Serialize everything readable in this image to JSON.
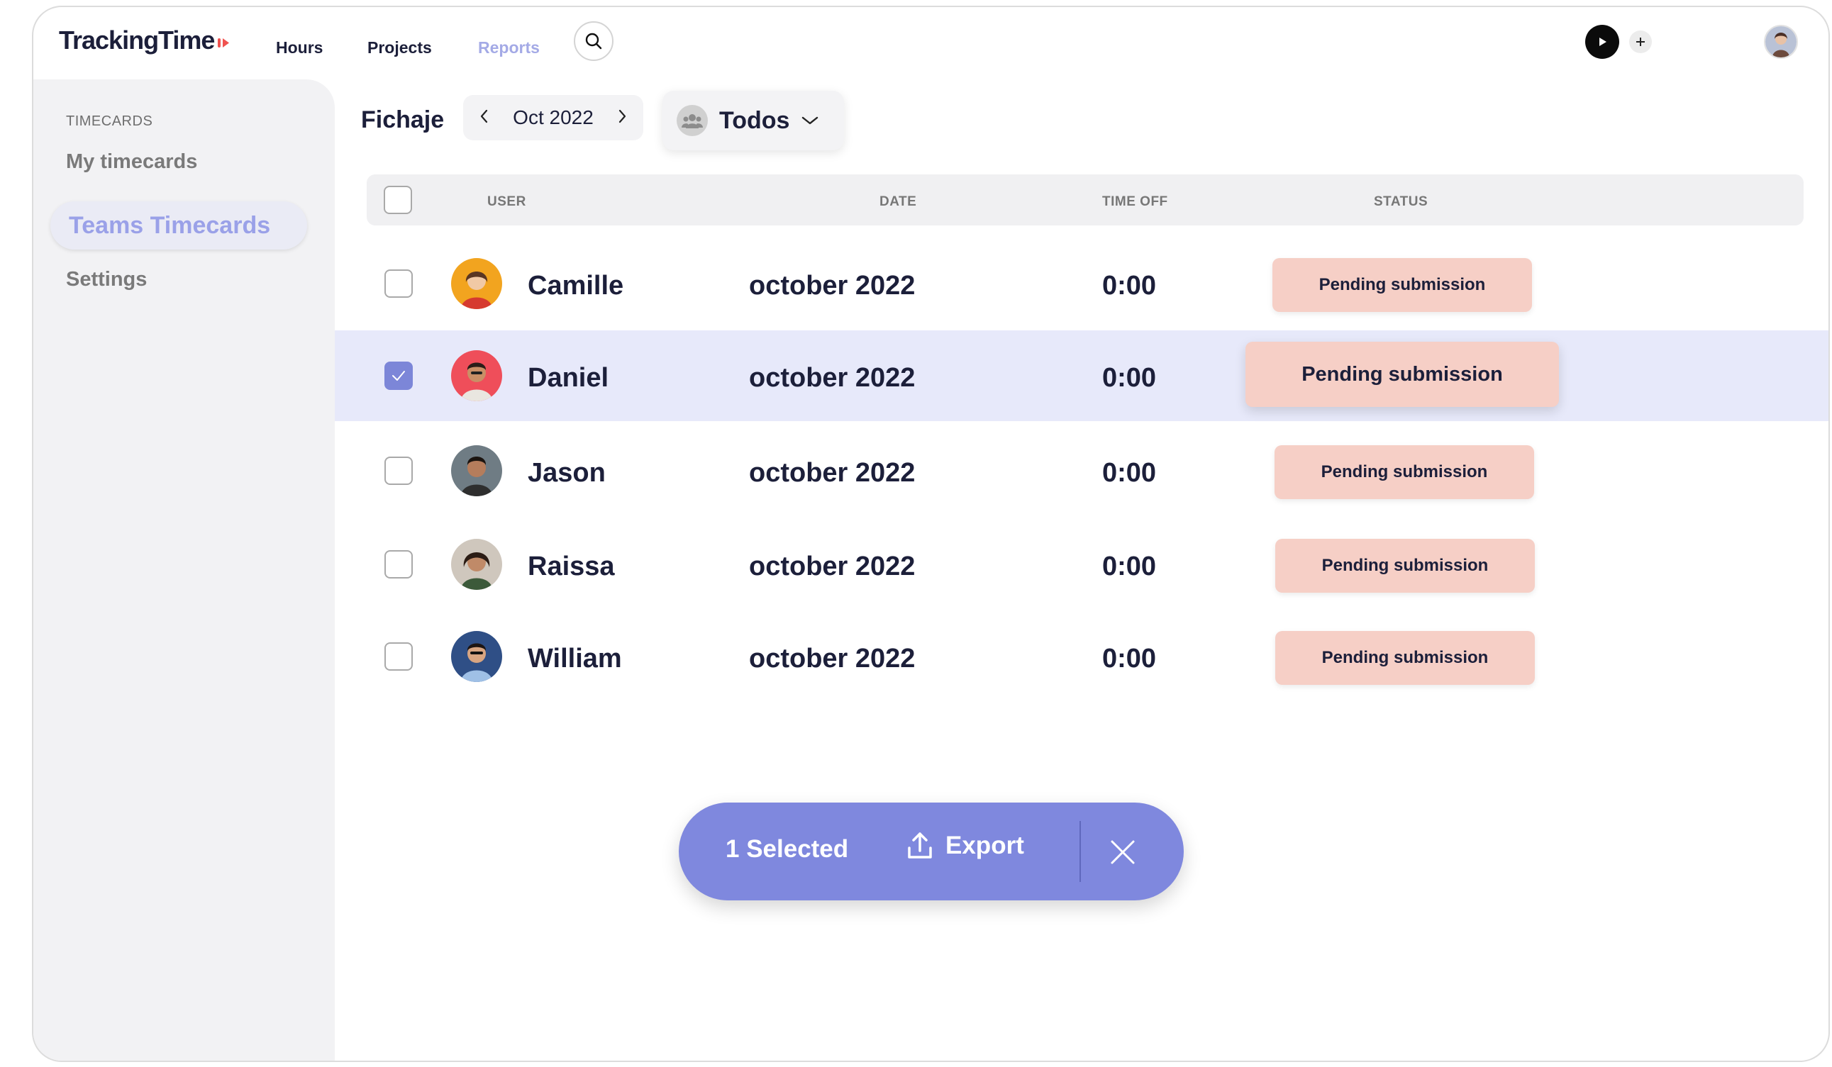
{
  "app": {
    "logo": "TrackingTime",
    "nav": {
      "hours": "Hours",
      "projects": "Projects",
      "reports": "Reports"
    },
    "accent_color": "#7f88de",
    "logo_mark_color": "#f0524f"
  },
  "sidebar": {
    "heading": "TIMECARDS",
    "items": [
      {
        "label": "My timecards",
        "active": false
      },
      {
        "label": "Teams Timecards",
        "active": true
      },
      {
        "label": "Settings",
        "active": false
      }
    ]
  },
  "main": {
    "title": "Fichaje",
    "month": "Oct 2022",
    "group_filter": "Todos"
  },
  "table": {
    "columns": {
      "user": "USER",
      "date": "DATE",
      "time_off": "TIME OFF",
      "status": "STATUS"
    },
    "rows": [
      {
        "name": "Camille",
        "date": "october 2022",
        "time_off": "0:00",
        "status": "Pending submission",
        "selected": false,
        "avatar_color": "#f2a41f"
      },
      {
        "name": "Daniel",
        "date": "october 2022",
        "time_off": "0:00",
        "status": "Pending submission",
        "selected": true,
        "avatar_color": "#ef4e5a"
      },
      {
        "name": "Jason",
        "date": "october 2022",
        "time_off": "0:00",
        "status": "Pending submission",
        "selected": false,
        "avatar_color": "#6f7c84"
      },
      {
        "name": "Raissa",
        "date": "october 2022",
        "time_off": "0:00",
        "status": "Pending submission",
        "selected": false,
        "avatar_color": "#cfc7bd"
      },
      {
        "name": "William",
        "date": "october 2022",
        "time_off": "0:00",
        "status": "Pending submission",
        "selected": false,
        "avatar_color": "#2f4f86"
      }
    ]
  },
  "selection_bar": {
    "count_label": "1 Selected",
    "export_label": "Export"
  }
}
